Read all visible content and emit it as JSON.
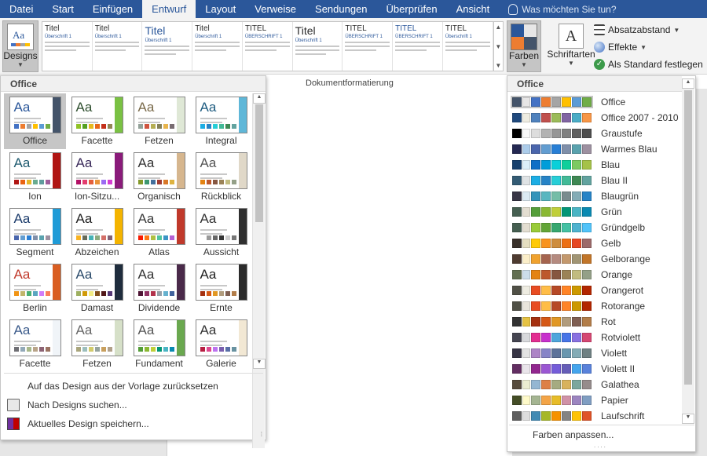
{
  "tabs": [
    {
      "label": "Datei"
    },
    {
      "label": "Start"
    },
    {
      "label": "Einfügen"
    },
    {
      "label": "Entwurf"
    },
    {
      "label": "Layout"
    },
    {
      "label": "Verweise"
    },
    {
      "label": "Sendungen"
    },
    {
      "label": "Überprüfen"
    },
    {
      "label": "Ansicht"
    }
  ],
  "tell_me": "Was möchten Sie tun?",
  "ribbon": {
    "designs_label": "Designs",
    "farben_label": "Farben",
    "schriftarten_label": "Schriftarten",
    "schriftarten_glyph": "A",
    "design_icon_text": "Aa",
    "absatzabstand_label": "Absatzabstand",
    "effekte_label": "Effekte",
    "standard_label": "Als Standard festlegen",
    "group_label": "Dokumentformatierung",
    "styles": [
      {
        "t1": "Titel",
        "t2": "Überschrift 1",
        "big": false,
        "blue": false
      },
      {
        "t1": "Titel",
        "t2": "Überschrift 1",
        "big": false,
        "blue": false
      },
      {
        "t1": "Titel",
        "t2": "Überschrift 1",
        "big": true,
        "blue": true
      },
      {
        "t1": "Titel",
        "t2": "Überschrift 1",
        "big": false,
        "blue": false
      },
      {
        "t1": "TITEL",
        "t2": "ÜBERSCHRIFT 1",
        "big": false,
        "blue": false
      },
      {
        "t1": "Titel",
        "t2": "Überschrift 1",
        "big": true,
        "blue": false
      },
      {
        "t1": "TITEL",
        "t2": "ÜBERSCHRIFT 1",
        "big": false,
        "blue": false
      },
      {
        "t1": "TITEL",
        "t2": "ÜBERSCHRIFT 1",
        "big": false,
        "blue": true
      },
      {
        "t1": "TITEL",
        "t2": "Überschrift 1",
        "big": false,
        "blue": false
      }
    ]
  },
  "designs_panel": {
    "header": "Office",
    "thumb_text": "Aa",
    "items": [
      {
        "name": "Office",
        "aa": "#2b579a",
        "deco": "#44546a",
        "dots": [
          "#4472c4",
          "#ed7d31",
          "#a5a5a5",
          "#ffc000",
          "#5b9bd5",
          "#70ad47"
        ]
      },
      {
        "name": "Facette",
        "aa": "#2f4f2f",
        "deco": "#7ac143",
        "dots": [
          "#90c226",
          "#54a021",
          "#e6b91e",
          "#e76618",
          "#c42f1a",
          "#918655"
        ]
      },
      {
        "name": "Fetzen",
        "aa": "#7a6a4a",
        "deco": "#dfe8d6",
        "dots": [
          "#93a299",
          "#cf543f",
          "#b5ae53",
          "#848058",
          "#e8b54d",
          "#786c71"
        ]
      },
      {
        "name": "Integral",
        "aa": "#1e5c80",
        "deco": "#5fb7d8",
        "dots": [
          "#1cade4",
          "#2683c6",
          "#27ced7",
          "#42ba97",
          "#3e8853",
          "#62a39f"
        ]
      },
      {
        "name": "Ion",
        "aa": "#1e5a6f",
        "deco": "#b01513",
        "dots": [
          "#b01513",
          "#ea6312",
          "#e6b729",
          "#6aac90",
          "#5f9c9d",
          "#9e5e9b"
        ]
      },
      {
        "name": "Ion-Sitzu...",
        "aa": "#3a2a5a",
        "deco": "#8a1b7a",
        "dots": [
          "#b31166",
          "#e33d6f",
          "#e45f3c",
          "#e9943a",
          "#9b6bf2",
          "#d53dd0"
        ]
      },
      {
        "name": "Organisch",
        "aa": "#333333",
        "deco": "#d6b68e",
        "dots": [
          "#83992a",
          "#3c9770",
          "#44709d",
          "#a23c33",
          "#d97828",
          "#deb340"
        ]
      },
      {
        "name": "Rückblick",
        "aa": "#555555",
        "deco": "#e0d8c8",
        "dots": [
          "#e48312",
          "#bd582c",
          "#865640",
          "#9b8357",
          "#c2bc80",
          "#94a088"
        ]
      },
      {
        "name": "Segment",
        "aa": "#1a3a6a",
        "deco": "#1f9bd7",
        "dots": [
          "#4a66ac",
          "#629dd1",
          "#297fd5",
          "#7f8fa9",
          "#5aa2ae",
          "#9d90a0"
        ]
      },
      {
        "name": "Abzeichen",
        "aa": "#222222",
        "deco": "#f4b400",
        "dots": [
          "#f8b323",
          "#656a59",
          "#46b2b5",
          "#8caa7e",
          "#d36f68",
          "#826276"
        ]
      },
      {
        "name": "Atlas",
        "aa": "#3a3a3a",
        "deco": "#c0392b",
        "dots": [
          "#f81b02",
          "#fc7715",
          "#afbf41",
          "#50c49f",
          "#3b95c4",
          "#b560d4"
        ]
      },
      {
        "name": "Aussicht",
        "aa": "#333333",
        "deco": "#2f2f2f",
        "dots": [
          "#ffffff",
          "#999999",
          "#666666",
          "#333333",
          "#cccccc",
          "#777777"
        ]
      },
      {
        "name": "Berlin",
        "aa": "#c0392b",
        "deco": "#d95e22",
        "dots": [
          "#f09415",
          "#c1b56b",
          "#4baf73",
          "#5aa6c0",
          "#d17df9",
          "#fa7e5c"
        ]
      },
      {
        "name": "Damast",
        "aa": "#2a4a6a",
        "deco": "#1f2d3d",
        "dots": [
          "#9eb060",
          "#d09a08",
          "#f2ec86",
          "#824f1c",
          "#511818",
          "#553876"
        ]
      },
      {
        "name": "Dividende",
        "aa": "#333333",
        "deco": "#4a2a4a",
        "dots": [
          "#4d1434",
          "#903163",
          "#b2324b",
          "#969fa7",
          "#66b1ce",
          "#40619d"
        ]
      },
      {
        "name": "Ernte",
        "aa": "#222222",
        "deco": "#2b2b2b",
        "dots": [
          "#a5300f",
          "#d55816",
          "#e19825",
          "#b19c7d",
          "#7f5f52",
          "#b27d49"
        ]
      },
      {
        "name": "Facette",
        "aa": "#3a5a8a",
        "deco": "#f0f4f8",
        "dots": [
          "#6f6f74",
          "#92a9b9",
          "#a7b789",
          "#b9a489",
          "#8d6374",
          "#9b7362"
        ]
      },
      {
        "name": "Fetzen",
        "aa": "#666666",
        "deco": "#d6e0c8",
        "dots": [
          "#a9a57c",
          "#9cbebd",
          "#d2cb6c",
          "#95a39d",
          "#c89f5d",
          "#b1a089"
        ]
      },
      {
        "name": "Fundament",
        "aa": "#555555",
        "deco": "#6aa84f",
        "dots": [
          "#549e39",
          "#8ab833",
          "#c0cf3a",
          "#029676",
          "#4ab5c4",
          "#0989b1"
        ]
      },
      {
        "name": "Galerie",
        "aa": "#333333",
        "deco": "#f2e8d4",
        "dots": [
          "#b71e42",
          "#de478e",
          "#bc72f0",
          "#795faf",
          "#586ea6",
          "#6892a0"
        ]
      }
    ],
    "menu": [
      {
        "label": "Auf das Design aus der Vorlage zurücksetzen",
        "icon": "none"
      },
      {
        "label": "Nach Designs suchen...",
        "icon": "folder-icon"
      },
      {
        "label": "Aktuelles Design speichern...",
        "icon": "save-theme-icon"
      }
    ]
  },
  "colors_panel": {
    "header": "Office",
    "footer": "Farben anpassen...",
    "items": [
      {
        "name": "Office",
        "colors": [
          "#44546a",
          "#e7e6e6",
          "#4472c4",
          "#ed7d31",
          "#a5a5a5",
          "#ffc000",
          "#5b9bd5",
          "#70ad47"
        ]
      },
      {
        "name": "Office 2007 - 2010",
        "colors": [
          "#1f497d",
          "#eeece1",
          "#4f81bd",
          "#c0504d",
          "#9bbb59",
          "#8064a2",
          "#4bacc6",
          "#f79646"
        ]
      },
      {
        "name": "Graustufe",
        "colors": [
          "#000000",
          "#f8f8f8",
          "#dddddd",
          "#b2b2b2",
          "#969696",
          "#808080",
          "#5f5f5f",
          "#4d4d4d"
        ]
      },
      {
        "name": "Warmes Blau",
        "colors": [
          "#242852",
          "#acccea",
          "#4a66ac",
          "#629dd1",
          "#297fd5",
          "#7f8fa9",
          "#5aa2ae",
          "#9d90a0"
        ]
      },
      {
        "name": "Blau",
        "colors": [
          "#17406d",
          "#dbeff9",
          "#0f6fc6",
          "#009dd9",
          "#0bd0d9",
          "#10cf9b",
          "#7cca62",
          "#a5c249"
        ]
      },
      {
        "name": "Blau II",
        "colors": [
          "#335b74",
          "#dfe3e5",
          "#1cade4",
          "#2683c6",
          "#27ced7",
          "#42ba97",
          "#3e8853",
          "#62a39f"
        ]
      },
      {
        "name": "Blaugrün",
        "colors": [
          "#373545",
          "#dceaf3",
          "#3494ba",
          "#58b6c0",
          "#75bda7",
          "#7a8c8e",
          "#84acb6",
          "#2683c6"
        ]
      },
      {
        "name": "Grün",
        "colors": [
          "#455f51",
          "#e3ded1",
          "#549e39",
          "#8ab833",
          "#c0cf3a",
          "#029676",
          "#4ab5c4",
          "#0989b1"
        ]
      },
      {
        "name": "Gründgelb",
        "colors": [
          "#455f51",
          "#e3ded1",
          "#99cb38",
          "#63a537",
          "#37a76f",
          "#44c1a3",
          "#4eb3cf",
          "#51c3f9"
        ]
      },
      {
        "name": "Gelb",
        "colors": [
          "#39302a",
          "#e5dec1",
          "#ffca08",
          "#f8931d",
          "#ce8d3e",
          "#ec7016",
          "#e64823",
          "#9c6a6a"
        ]
      },
      {
        "name": "Gelborange",
        "colors": [
          "#4e3b30",
          "#fbeec9",
          "#f0a22e",
          "#a5644e",
          "#b58b80",
          "#c3986d",
          "#a19574",
          "#c17529"
        ]
      },
      {
        "name": "Orange",
        "colors": [
          "#637052",
          "#ccddea",
          "#e48312",
          "#bd582c",
          "#865640",
          "#9b8357",
          "#c2bc80",
          "#94a088"
        ]
      },
      {
        "name": "Orangerot",
        "colors": [
          "#505046",
          "#eeece1",
          "#e84c22",
          "#ffbd47",
          "#b64926",
          "#ff8427",
          "#cc9900",
          "#b22600"
        ]
      },
      {
        "name": "Rotorange",
        "colors": [
          "#505046",
          "#e9e5dc",
          "#e84c22",
          "#ffbd47",
          "#b64926",
          "#ff8427",
          "#cc9900",
          "#b22600"
        ]
      },
      {
        "name": "Rot",
        "colors": [
          "#323232",
          "#e5c243",
          "#a5300f",
          "#d55816",
          "#e19825",
          "#b19c7d",
          "#7f5f52",
          "#b27d49"
        ]
      },
      {
        "name": "Rotviolett",
        "colors": [
          "#454551",
          "#d8d9dc",
          "#e32d91",
          "#c830cc",
          "#4ea6dc",
          "#4775e7",
          "#8971e1",
          "#d54773"
        ]
      },
      {
        "name": "Violett",
        "colors": [
          "#373545",
          "#e3e3e3",
          "#ad84c6",
          "#8784c7",
          "#5d739a",
          "#6997af",
          "#84acb6",
          "#6f8183"
        ]
      },
      {
        "name": "Violett II",
        "colors": [
          "#632e62",
          "#eae5eb",
          "#92278f",
          "#9b57d3",
          "#755dd9",
          "#665eb8",
          "#45a5ed",
          "#5982db"
        ]
      },
      {
        "name": "Galathea",
        "colors": [
          "#564b3c",
          "#ecedd1",
          "#94b6d2",
          "#dd8047",
          "#a5ab81",
          "#d8b25c",
          "#7ba79d",
          "#968c8c"
        ]
      },
      {
        "name": "Papier",
        "colors": [
          "#444d26",
          "#fefac9",
          "#a5b592",
          "#f3a447",
          "#e7bc29",
          "#d092a7",
          "#9c85c0",
          "#809ec2"
        ]
      },
      {
        "name": "Laufschrift",
        "colors": [
          "#5e5e5e",
          "#dddddd",
          "#418ab3",
          "#a6b727",
          "#f69200",
          "#838383",
          "#fec306",
          "#df5327"
        ]
      }
    ]
  }
}
